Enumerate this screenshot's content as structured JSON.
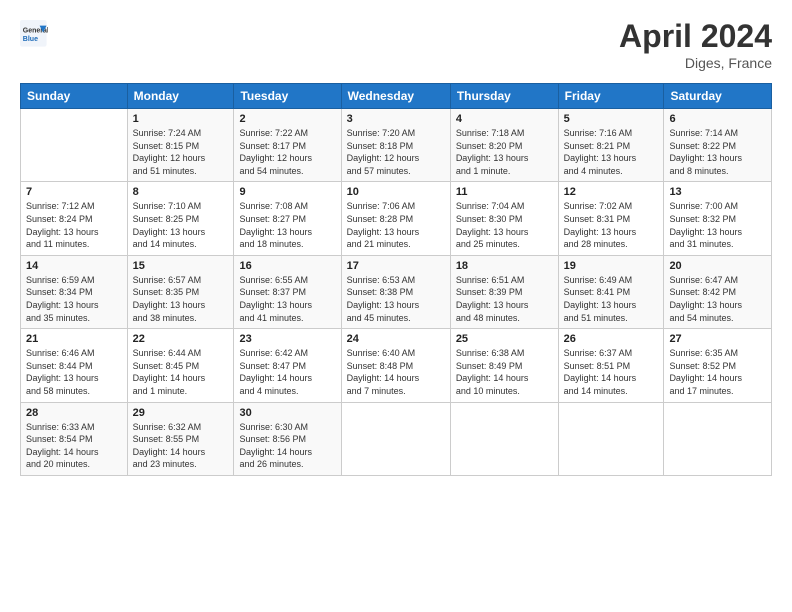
{
  "header": {
    "logo_general": "General",
    "logo_blue": "Blue",
    "month": "April 2024",
    "location": "Diges, France"
  },
  "days_of_week": [
    "Sunday",
    "Monday",
    "Tuesday",
    "Wednesday",
    "Thursday",
    "Friday",
    "Saturday"
  ],
  "weeks": [
    [
      {
        "day": "",
        "info": ""
      },
      {
        "day": "1",
        "info": "Sunrise: 7:24 AM\nSunset: 8:15 PM\nDaylight: 12 hours\nand 51 minutes."
      },
      {
        "day": "2",
        "info": "Sunrise: 7:22 AM\nSunset: 8:17 PM\nDaylight: 12 hours\nand 54 minutes."
      },
      {
        "day": "3",
        "info": "Sunrise: 7:20 AM\nSunset: 8:18 PM\nDaylight: 12 hours\nand 57 minutes."
      },
      {
        "day": "4",
        "info": "Sunrise: 7:18 AM\nSunset: 8:20 PM\nDaylight: 13 hours\nand 1 minute."
      },
      {
        "day": "5",
        "info": "Sunrise: 7:16 AM\nSunset: 8:21 PM\nDaylight: 13 hours\nand 4 minutes."
      },
      {
        "day": "6",
        "info": "Sunrise: 7:14 AM\nSunset: 8:22 PM\nDaylight: 13 hours\nand 8 minutes."
      }
    ],
    [
      {
        "day": "7",
        "info": "Sunrise: 7:12 AM\nSunset: 8:24 PM\nDaylight: 13 hours\nand 11 minutes."
      },
      {
        "day": "8",
        "info": "Sunrise: 7:10 AM\nSunset: 8:25 PM\nDaylight: 13 hours\nand 14 minutes."
      },
      {
        "day": "9",
        "info": "Sunrise: 7:08 AM\nSunset: 8:27 PM\nDaylight: 13 hours\nand 18 minutes."
      },
      {
        "day": "10",
        "info": "Sunrise: 7:06 AM\nSunset: 8:28 PM\nDaylight: 13 hours\nand 21 minutes."
      },
      {
        "day": "11",
        "info": "Sunrise: 7:04 AM\nSunset: 8:30 PM\nDaylight: 13 hours\nand 25 minutes."
      },
      {
        "day": "12",
        "info": "Sunrise: 7:02 AM\nSunset: 8:31 PM\nDaylight: 13 hours\nand 28 minutes."
      },
      {
        "day": "13",
        "info": "Sunrise: 7:00 AM\nSunset: 8:32 PM\nDaylight: 13 hours\nand 31 minutes."
      }
    ],
    [
      {
        "day": "14",
        "info": "Sunrise: 6:59 AM\nSunset: 8:34 PM\nDaylight: 13 hours\nand 35 minutes."
      },
      {
        "day": "15",
        "info": "Sunrise: 6:57 AM\nSunset: 8:35 PM\nDaylight: 13 hours\nand 38 minutes."
      },
      {
        "day": "16",
        "info": "Sunrise: 6:55 AM\nSunset: 8:37 PM\nDaylight: 13 hours\nand 41 minutes."
      },
      {
        "day": "17",
        "info": "Sunrise: 6:53 AM\nSunset: 8:38 PM\nDaylight: 13 hours\nand 45 minutes."
      },
      {
        "day": "18",
        "info": "Sunrise: 6:51 AM\nSunset: 8:39 PM\nDaylight: 13 hours\nand 48 minutes."
      },
      {
        "day": "19",
        "info": "Sunrise: 6:49 AM\nSunset: 8:41 PM\nDaylight: 13 hours\nand 51 minutes."
      },
      {
        "day": "20",
        "info": "Sunrise: 6:47 AM\nSunset: 8:42 PM\nDaylight: 13 hours\nand 54 minutes."
      }
    ],
    [
      {
        "day": "21",
        "info": "Sunrise: 6:46 AM\nSunset: 8:44 PM\nDaylight: 13 hours\nand 58 minutes."
      },
      {
        "day": "22",
        "info": "Sunrise: 6:44 AM\nSunset: 8:45 PM\nDaylight: 14 hours\nand 1 minute."
      },
      {
        "day": "23",
        "info": "Sunrise: 6:42 AM\nSunset: 8:47 PM\nDaylight: 14 hours\nand 4 minutes."
      },
      {
        "day": "24",
        "info": "Sunrise: 6:40 AM\nSunset: 8:48 PM\nDaylight: 14 hours\nand 7 minutes."
      },
      {
        "day": "25",
        "info": "Sunrise: 6:38 AM\nSunset: 8:49 PM\nDaylight: 14 hours\nand 10 minutes."
      },
      {
        "day": "26",
        "info": "Sunrise: 6:37 AM\nSunset: 8:51 PM\nDaylight: 14 hours\nand 14 minutes."
      },
      {
        "day": "27",
        "info": "Sunrise: 6:35 AM\nSunset: 8:52 PM\nDaylight: 14 hours\nand 17 minutes."
      }
    ],
    [
      {
        "day": "28",
        "info": "Sunrise: 6:33 AM\nSunset: 8:54 PM\nDaylight: 14 hours\nand 20 minutes."
      },
      {
        "day": "29",
        "info": "Sunrise: 6:32 AM\nSunset: 8:55 PM\nDaylight: 14 hours\nand 23 minutes."
      },
      {
        "day": "30",
        "info": "Sunrise: 6:30 AM\nSunset: 8:56 PM\nDaylight: 14 hours\nand 26 minutes."
      },
      {
        "day": "",
        "info": ""
      },
      {
        "day": "",
        "info": ""
      },
      {
        "day": "",
        "info": ""
      },
      {
        "day": "",
        "info": ""
      }
    ]
  ]
}
